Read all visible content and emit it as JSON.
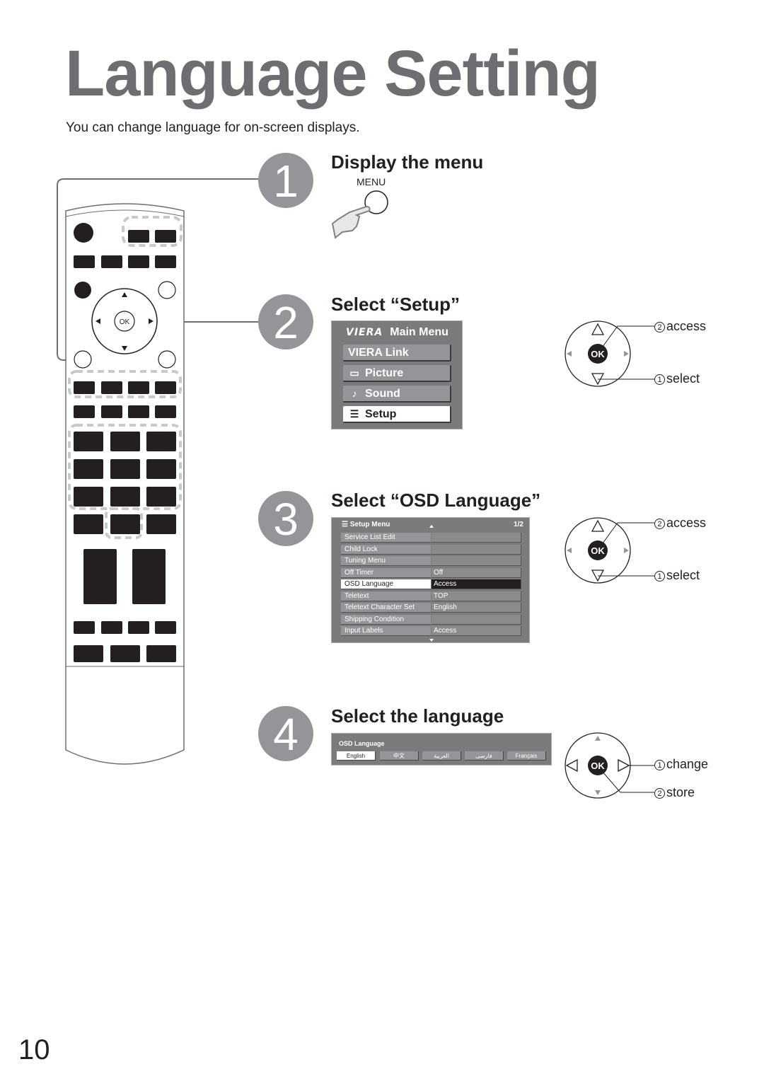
{
  "page": {
    "title": "Language Setting",
    "subtitle": "You can change language for on-screen displays.",
    "page_number": "10"
  },
  "steps": [
    {
      "number": "1",
      "title": "Display the menu",
      "button_label": "MENU"
    },
    {
      "number": "2",
      "title": "Select “Setup”"
    },
    {
      "number": "3",
      "title": "Select “OSD Language”"
    },
    {
      "number": "4",
      "title": "Select the language"
    }
  ],
  "main_menu": {
    "brand": "VIERA",
    "title": "Main Menu",
    "items": [
      {
        "label": "VIERA Link",
        "icon": "",
        "selected": false
      },
      {
        "label": "Picture",
        "icon": "picture-icon",
        "selected": false
      },
      {
        "label": "Sound",
        "icon": "music-note-icon",
        "selected": false
      },
      {
        "label": "Setup",
        "icon": "list-icon",
        "selected": true
      }
    ]
  },
  "setup_menu": {
    "title": "Setup Menu",
    "page": "1/2",
    "rows": [
      {
        "label": "Service List Edit",
        "value": ""
      },
      {
        "label": "Child Lock",
        "value": ""
      },
      {
        "label": "Tuning Menu",
        "value": ""
      },
      {
        "label": "Off Timer",
        "value": "Off"
      },
      {
        "label": "OSD Language",
        "value": "Access",
        "selected": true
      },
      {
        "label": "Teletext",
        "value": "TOP"
      },
      {
        "label": "Teletext Character Set",
        "value": "English"
      },
      {
        "label": "Shipping Condition",
        "value": ""
      },
      {
        "label": "Input Labels",
        "value": "Access"
      }
    ]
  },
  "osd_language": {
    "title": "OSD Language",
    "options": [
      "English",
      "中文",
      "العربية",
      "فارسی",
      "Français"
    ],
    "selected": "English"
  },
  "dpad_instructions": [
    {
      "ok_label": "OK",
      "actions": [
        {
          "num": "2",
          "text": "access"
        },
        {
          "num": "1",
          "text": "select"
        }
      ]
    },
    {
      "ok_label": "OK",
      "actions": [
        {
          "num": "2",
          "text": "access"
        },
        {
          "num": "1",
          "text": "select"
        }
      ]
    },
    {
      "ok_label": "OK",
      "actions": [
        {
          "num": "1",
          "text": "change"
        },
        {
          "num": "2",
          "text": "store"
        }
      ]
    }
  ],
  "remote": {
    "ok_label": "OK"
  },
  "colors": {
    "title_gray": "#6d6e71",
    "step_circle": "#939598",
    "menu_bg": "#7a7b7d",
    "menu_item": "#939598",
    "button_black": "#231f20"
  }
}
